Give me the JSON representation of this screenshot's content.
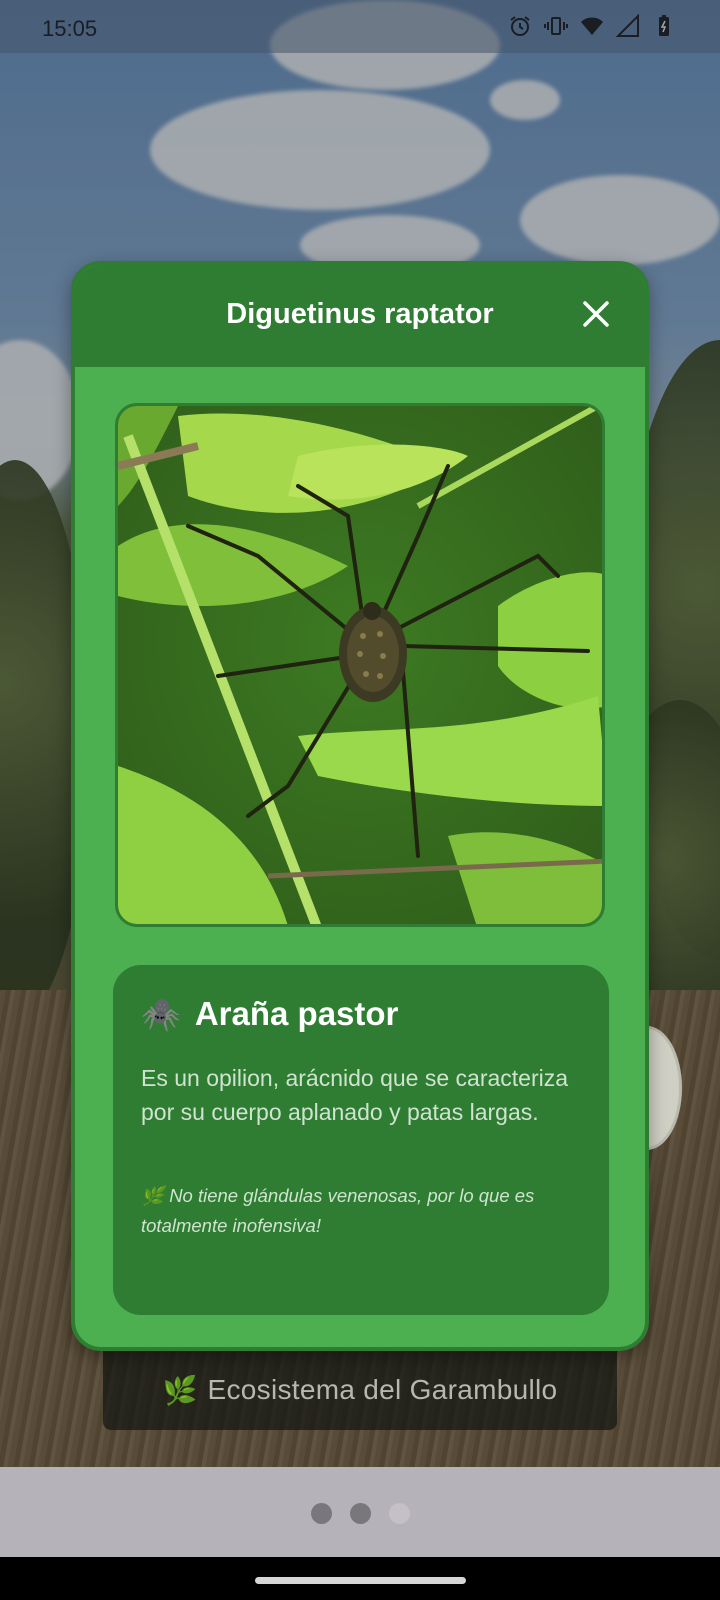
{
  "status_bar": {
    "time": "15:05",
    "icons": [
      "alarm-icon",
      "vibrate-icon",
      "wifi-icon",
      "signal-icon",
      "battery-icon"
    ]
  },
  "dialog": {
    "title": "Diguetinus raptator",
    "close_icon": "close-icon",
    "photo_icon": "spider-photo",
    "card": {
      "emoji": "🕷️",
      "name": "Araña pastor",
      "description": "Es un opilion, arácnido que se caracteriza por su cuerpo aplanado y patas largas.",
      "note_emoji": "🌿",
      "note": "No tiene glándulas venenosas, por lo que es totalmente inofensiva!"
    }
  },
  "banner": {
    "emoji": "🌿",
    "text": "Ecosistema del Garambullo"
  },
  "pager": {
    "count": 3,
    "active_index": 2
  },
  "colors": {
    "dialog_bg": "#4caf50",
    "dialog_header": "#2e7d32",
    "card_bg": "#2e7d32"
  }
}
